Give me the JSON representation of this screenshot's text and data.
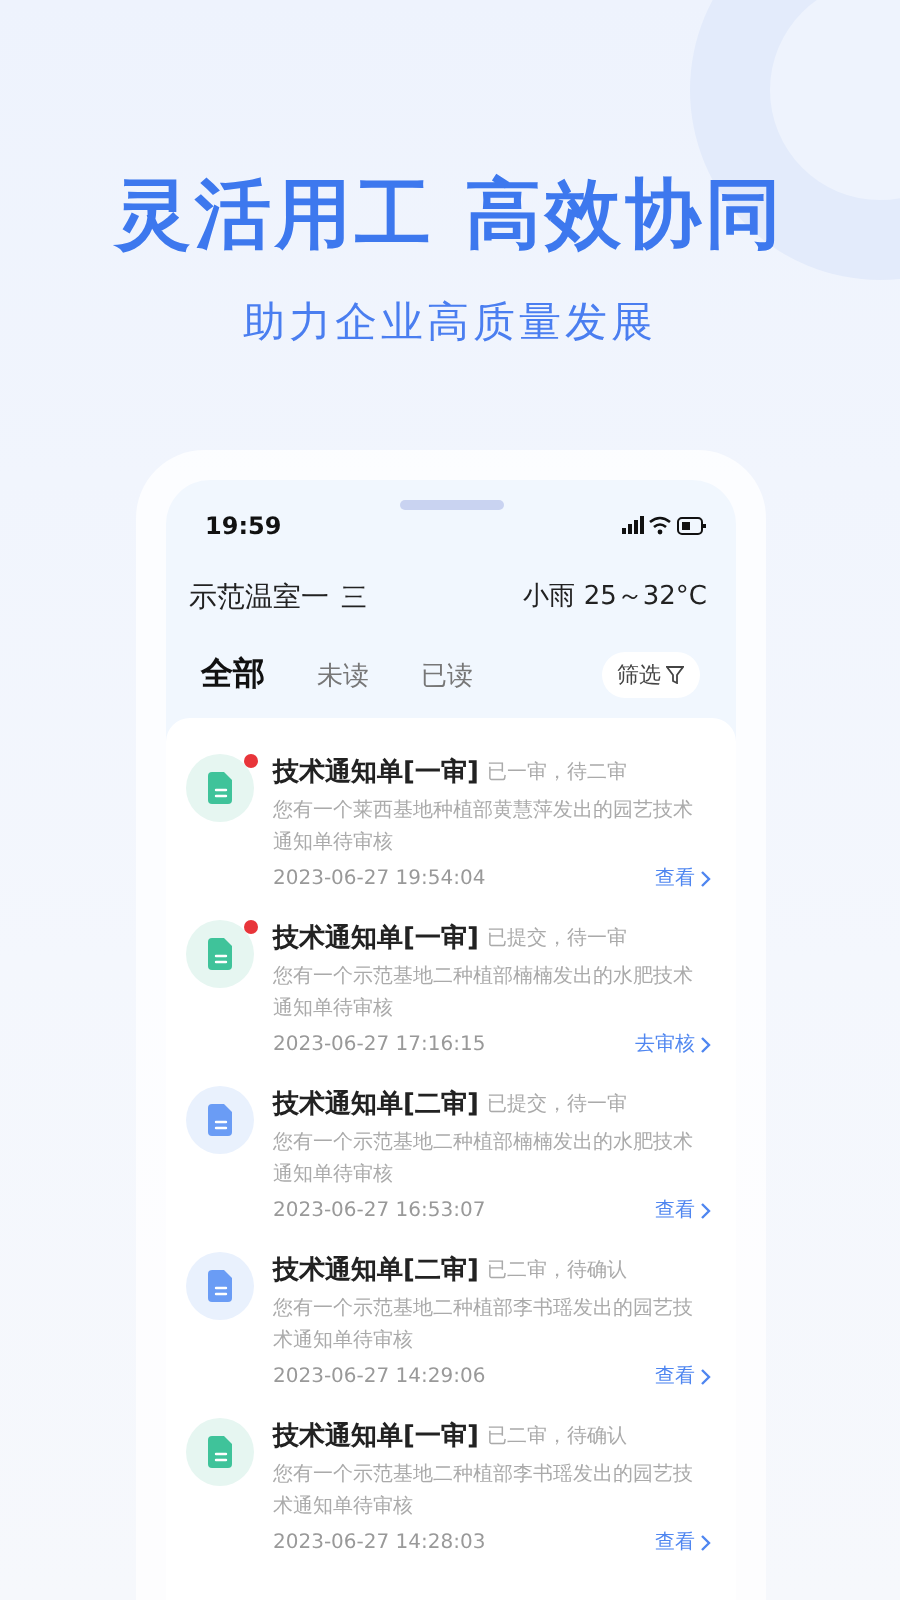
{
  "headline": "灵活用工 高效协同",
  "subtitle": "助力企业高质量发展",
  "status_bar": {
    "time": "19:59"
  },
  "header": {
    "location": "示范温室一",
    "menu_glyph": "三",
    "weather": "小雨 25～32°C"
  },
  "tabs": [
    {
      "label": "全部",
      "selected": true
    },
    {
      "label": "未读",
      "selected": false
    },
    {
      "label": "已读",
      "selected": false
    }
  ],
  "filter_button": "筛选",
  "notices": [
    {
      "kind": "green",
      "unread": true,
      "title": "技术通知单[一审]",
      "status": "已一审，待二审",
      "description": "您有一个莱西基地种植部黄慧萍发出的园艺技术通知单待审核",
      "time": "2023-06-27 19:54:04",
      "action": "查看"
    },
    {
      "kind": "green",
      "unread": true,
      "title": "技术通知单[一审]",
      "status": "已提交，待一审",
      "description": "您有一个示范基地二种植部楠楠发出的水肥技术通知单待审核",
      "time": "2023-06-27 17:16:15",
      "action": "去审核"
    },
    {
      "kind": "blue",
      "unread": false,
      "title": "技术通知单[二审]",
      "status": "已提交，待一审",
      "description": "您有一个示范基地二种植部楠楠发出的水肥技术通知单待审核",
      "time": "2023-06-27 16:53:07",
      "action": "查看"
    },
    {
      "kind": "blue",
      "unread": false,
      "title": "技术通知单[二审]",
      "status": "已二审，待确认",
      "description": "您有一个示范基地二种植部李书瑶发出的园艺技术通知单待审核",
      "time": "2023-06-27 14:29:06",
      "action": "查看"
    },
    {
      "kind": "green",
      "unread": false,
      "title": "技术通知单[一审]",
      "status": "已二审，待确认",
      "description": "您有一个示范基地二种植部李书瑶发出的园艺技术通知单待审核",
      "time": "2023-06-27 14:28:03",
      "action": "查看"
    }
  ]
}
